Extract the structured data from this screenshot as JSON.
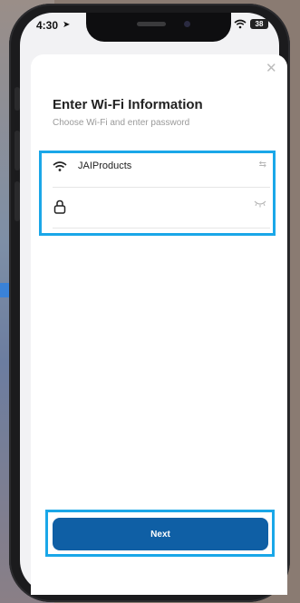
{
  "status_bar": {
    "time": "4:30",
    "battery": "38"
  },
  "dialog": {
    "title": "Enter Wi-Fi Information",
    "subtitle": "Choose Wi-Fi and enter password",
    "close_icon": "close-icon",
    "wifi_field": {
      "network_name": "JAIProducts",
      "lead_icon": "wifi-icon",
      "trail_icon": "switch-network-icon"
    },
    "password_field": {
      "value": "",
      "lead_icon": "lock-icon",
      "trail_icon": "eye-closed-icon"
    },
    "next_label": "Next"
  },
  "highlight_color": "#1aa7e8",
  "button_color": "#0f5fa5"
}
